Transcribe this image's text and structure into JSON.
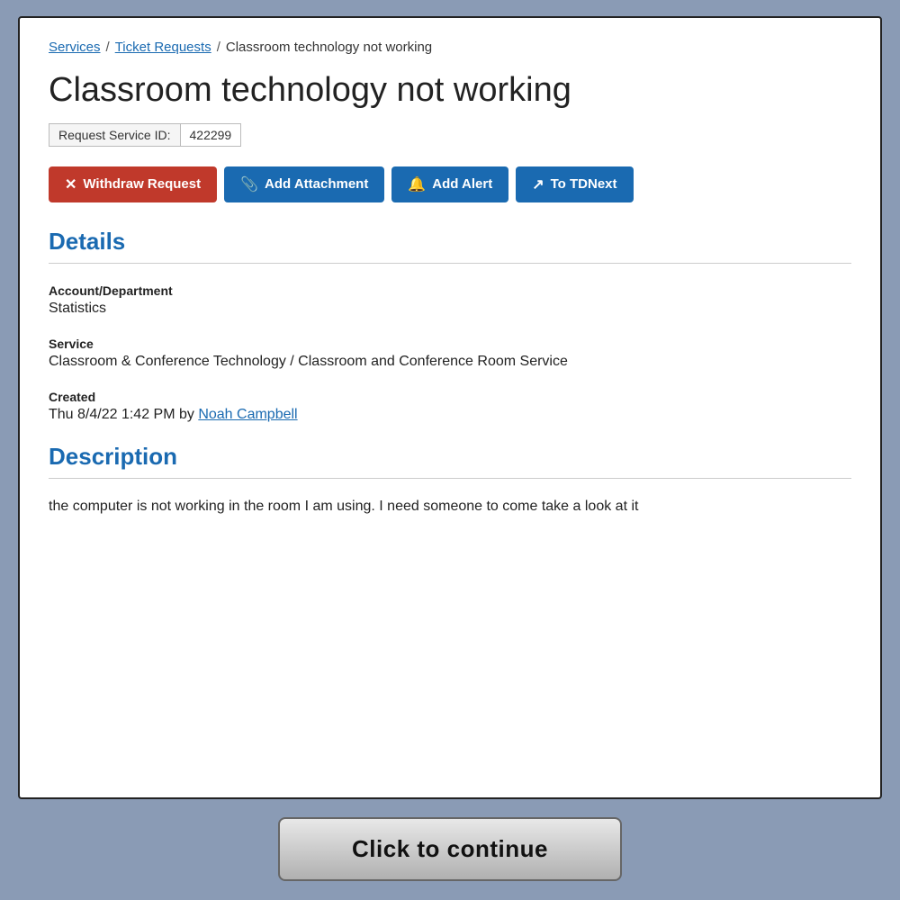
{
  "breadcrumb": {
    "services_label": "Services",
    "ticket_requests_label": "Ticket Requests",
    "current_label": "Classroom technology not working",
    "separator": "/"
  },
  "page_title": "Classroom technology not working",
  "service_id": {
    "label": "Request Service ID:",
    "value": "422299"
  },
  "buttons": {
    "withdraw": "Withdraw Request",
    "add_attachment": "Add Attachment",
    "add_alert": "Add Alert",
    "to_tdnext": "To TDNext"
  },
  "details_heading": "Details",
  "fields": {
    "account_department": {
      "label": "Account/Department",
      "value": "Statistics"
    },
    "service": {
      "label": "Service",
      "value": "Classroom & Conference Technology / Classroom and Conference Room Service"
    },
    "created": {
      "label": "Created",
      "date_text": "Thu 8/4/22 1:42 PM by ",
      "creator_name": "Noah Campbell"
    }
  },
  "description_heading": "Description",
  "description_text": "the computer is not working in the room I am using. I need someone to come take a look at it",
  "continue_button": "Click to continue"
}
